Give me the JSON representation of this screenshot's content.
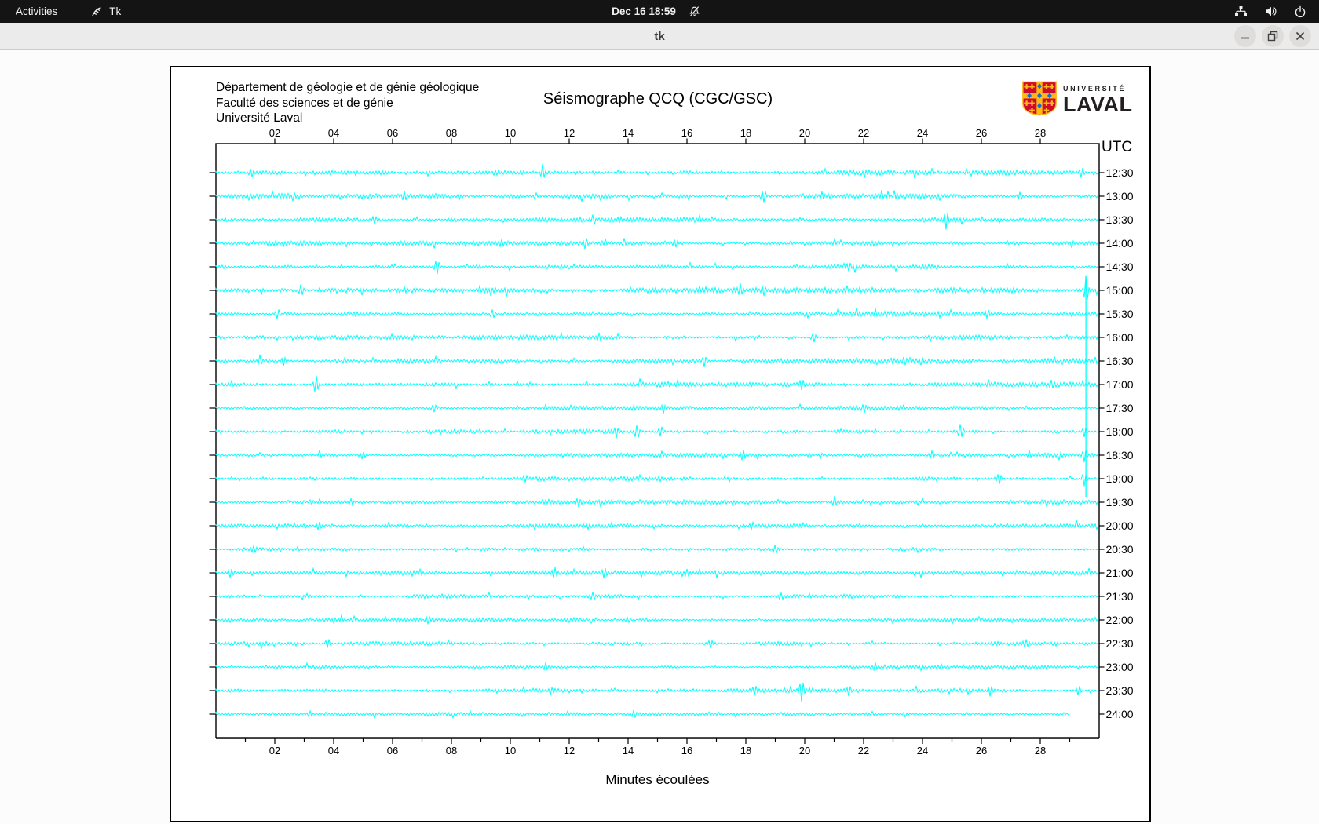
{
  "topbar": {
    "activities": "Activities",
    "app_name": "Tk",
    "clock": "Dec 16 18:59",
    "icons": [
      "tk-icon",
      "notifications-muted-icon",
      "network-wired-icon",
      "volume-icon",
      "power-icon"
    ]
  },
  "window": {
    "title": "tk",
    "buttons": [
      "minimize",
      "restore",
      "close"
    ]
  },
  "seismograph": {
    "header_lines": [
      "Département de géologie et de génie géologique",
      "Faculté des sciences et de génie",
      "Université Laval"
    ],
    "title": "Séismographe QCQ (CGC/GSC)",
    "logo": {
      "line1": "UNIVERSITÉ",
      "line2": "LAVAL"
    },
    "utc_label": "UTC",
    "utc_color": "#ff0000",
    "trace_color": "#00ffff",
    "xlabel": "Minutes écoulées"
  },
  "chart_data": {
    "type": "line",
    "title": "Séismographe QCQ (CGC/GSC)",
    "xlabel": "Minutes écoulées",
    "x_range": [
      0,
      30
    ],
    "x_tick_labels": [
      "02",
      "04",
      "06",
      "08",
      "10",
      "12",
      "14",
      "16",
      "18",
      "20",
      "22",
      "24",
      "26",
      "28"
    ],
    "x_tick_minutes": [
      2,
      4,
      6,
      8,
      10,
      12,
      14,
      16,
      18,
      20,
      22,
      24,
      26,
      28
    ],
    "minor_tick_every_min": 1,
    "y_axis_side": "right",
    "y_axis_title": "UTC",
    "grid": false,
    "trace_color": "#00ffff",
    "rows": [
      {
        "time": "12:30",
        "amp": 3.0,
        "spikes": [
          [
            1.2,
            7
          ],
          [
            11.1,
            12
          ],
          [
            29.4,
            9
          ]
        ]
      },
      {
        "time": "13:00",
        "amp": 2.8,
        "spikes": [
          [
            6.4,
            7
          ],
          [
            18.6,
            11
          ],
          [
            27.3,
            7
          ]
        ]
      },
      {
        "time": "13:30",
        "amp": 2.8,
        "spikes": [
          [
            5.4,
            7
          ],
          [
            24.8,
            15
          ]
        ]
      },
      {
        "time": "14:00",
        "amp": 2.6,
        "spikes": [
          [
            9.7,
            6
          ],
          [
            15.6,
            8
          ]
        ]
      },
      {
        "time": "14:30",
        "amp": 2.6,
        "spikes": [
          [
            7.5,
            16
          ],
          [
            21.5,
            6
          ]
        ]
      },
      {
        "time": "15:00",
        "amp": 3.0,
        "spikes": [
          [
            2.9,
            9
          ],
          [
            17.8,
            9
          ],
          [
            18.6,
            8
          ],
          [
            29.55,
            20
          ]
        ]
      },
      {
        "time": "15:30",
        "amp": 2.8,
        "spikes": [
          [
            2.1,
            7
          ],
          [
            9.4,
            7
          ],
          [
            26.2,
            6
          ]
        ]
      },
      {
        "time": "16:00",
        "amp": 2.6,
        "spikes": [
          [
            13.0,
            6
          ],
          [
            20.3,
            8
          ]
        ]
      },
      {
        "time": "16:30",
        "amp": 3.0,
        "spikes": [
          [
            1.5,
            8
          ],
          [
            2.3,
            7
          ],
          [
            16.6,
            8
          ],
          [
            23.4,
            6
          ]
        ]
      },
      {
        "time": "17:00",
        "amp": 2.8,
        "spikes": [
          [
            3.4,
            13
          ],
          [
            19.9,
            10
          ],
          [
            28.4,
            6
          ]
        ]
      },
      {
        "time": "17:30",
        "amp": 2.5,
        "spikes": [
          [
            7.4,
            6
          ],
          [
            15.2,
            6
          ],
          [
            22.0,
            6
          ]
        ]
      },
      {
        "time": "18:00",
        "amp": 2.8,
        "spikes": [
          [
            13.6,
            10
          ],
          [
            14.3,
            12
          ],
          [
            15.1,
            9
          ],
          [
            25.3,
            13
          ],
          [
            29.5,
            8
          ]
        ]
      },
      {
        "time": "18:30",
        "amp": 2.6,
        "spikes": [
          [
            5.0,
            6
          ],
          [
            17.9,
            7
          ],
          [
            24.3,
            8
          ],
          [
            29.5,
            10
          ]
        ]
      },
      {
        "time": "19:00",
        "amp": 2.5,
        "spikes": [
          [
            10.5,
            6
          ],
          [
            26.6,
            8
          ],
          [
            29.5,
            12
          ]
        ]
      },
      {
        "time": "19:30",
        "amp": 2.5,
        "spikes": [
          [
            4.6,
            6
          ],
          [
            12.3,
            7
          ],
          [
            21.0,
            8
          ]
        ]
      },
      {
        "time": "20:00",
        "amp": 2.3,
        "spikes": [
          [
            3.5,
            8
          ],
          [
            18.2,
            5
          ]
        ]
      },
      {
        "time": "20:30",
        "amp": 2.3,
        "spikes": [
          [
            1.3,
            6
          ],
          [
            19.0,
            7
          ]
        ]
      },
      {
        "time": "21:00",
        "amp": 2.5,
        "spikes": [
          [
            0.5,
            7
          ],
          [
            11.5,
            8
          ],
          [
            13.2,
            9
          ],
          [
            16.0,
            6
          ]
        ]
      },
      {
        "time": "21:30",
        "amp": 2.2,
        "spikes": [
          [
            12.8,
            7
          ],
          [
            19.2,
            6
          ]
        ]
      },
      {
        "time": "22:00",
        "amp": 2.1,
        "spikes": [
          [
            7.2,
            6
          ],
          [
            14.0,
            5
          ]
        ]
      },
      {
        "time": "22:30",
        "amp": 2.2,
        "spikes": [
          [
            3.8,
            9
          ],
          [
            16.8,
            6
          ],
          [
            27.5,
            7
          ]
        ]
      },
      {
        "time": "23:00",
        "amp": 2.0,
        "spikes": [
          [
            11.2,
            5
          ],
          [
            22.4,
            6
          ]
        ]
      },
      {
        "time": "23:30",
        "amp": 2.3,
        "spikes": [
          [
            18.3,
            8
          ],
          [
            19.9,
            18
          ],
          [
            21.5,
            7
          ],
          [
            26.3,
            9
          ],
          [
            29.3,
            7
          ]
        ]
      },
      {
        "time": "24:00",
        "amp": 1.9,
        "end_minute": 29.0,
        "spikes": [
          [
            3.2,
            5
          ],
          [
            14.2,
            6
          ]
        ]
      }
    ],
    "event_line": {
      "minute": 29.55,
      "start_row": 5,
      "end_row": 13
    }
  }
}
